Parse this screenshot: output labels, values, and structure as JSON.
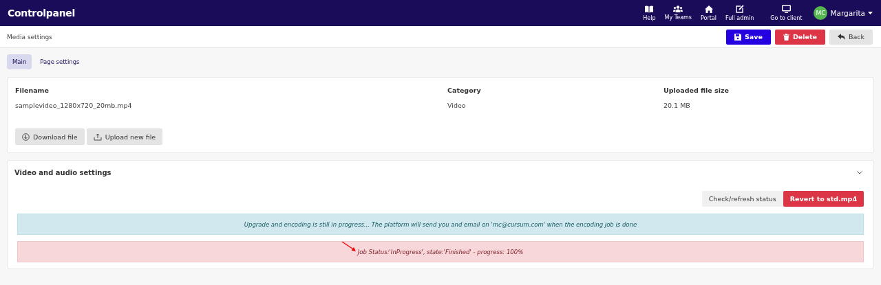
{
  "topbar": {
    "brand": "Controlpanel",
    "nav": [
      {
        "label": "Help",
        "kind": "book"
      },
      {
        "label": "My Teams",
        "kind": "team"
      },
      {
        "label": "Portal",
        "kind": "home"
      },
      {
        "label": "Full admin",
        "kind": "edit"
      },
      {
        "label": "Go to client",
        "kind": "monitor"
      }
    ],
    "user": {
      "initials": "MC",
      "name": "Margarita"
    }
  },
  "page": {
    "title": "Media settings",
    "actions": [
      {
        "label": "Save",
        "kind": "primary"
      },
      {
        "label": "Delete",
        "kind": "danger"
      },
      {
        "label": "Back",
        "kind": "secondary"
      }
    ]
  },
  "tabs": [
    {
      "label": "Main",
      "selected": true
    },
    {
      "label": "Page settings",
      "selected": false
    }
  ],
  "file": {
    "fields": [
      {
        "label": "Filename",
        "value": "samplevideo_1280x720_20mb.mp4"
      },
      {
        "label": "Category",
        "value": "Video"
      },
      {
        "label": "Uploaded file size",
        "value": "20.1 MB"
      }
    ],
    "buttons": [
      {
        "label": "Download file",
        "kind": "download"
      },
      {
        "label": "Upload new file",
        "kind": "upload"
      }
    ]
  },
  "video_section": {
    "title": "Video and audio settings",
    "expanded": true,
    "buttons": [
      {
        "label": "Check/refresh status",
        "kind": "secondary"
      },
      {
        "label": "Revert to std.mp4",
        "kind": "danger"
      }
    ],
    "alerts": [
      {
        "kind": "info",
        "text": "Upgrade and encoding is still in progress... The platform will send you and email on 'mc@cursum.com' when the encoding job is done"
      },
      {
        "kind": "danger",
        "text": "Job Status:'InProgress', state:'Finished' - progress: 100%"
      }
    ]
  }
}
